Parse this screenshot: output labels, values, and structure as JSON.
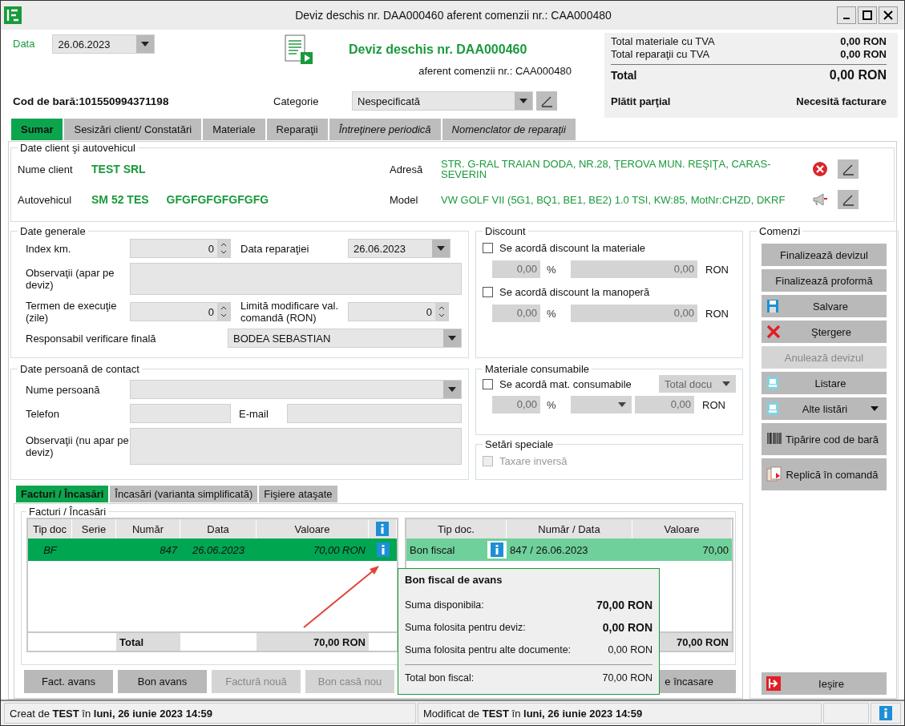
{
  "window": {
    "title": "Deviz deschis nr. DAA000460 aferent comenzii nr.: CAA000480"
  },
  "header": {
    "date_label": "Data",
    "date": "26.06.2023",
    "doc_title": "Deviz deschis nr. DAA000460",
    "order_ref": "aferent comenzii nr.: CAA000480",
    "barcode": "Cod de bară:101550994371198",
    "category_label": "Categorie",
    "category": "Nespecificată"
  },
  "totals": {
    "lines": [
      {
        "label": "Total materiale cu TVA",
        "value": "0,00 RON"
      },
      {
        "label": "Total reparaţii cu TVA",
        "value": "0,00 RON"
      }
    ],
    "total_label": "Total",
    "total": "0,00 RON",
    "payment_status": "Plătit parţial",
    "billing_status": "Necesită facturare"
  },
  "tabs": [
    {
      "label": "Sumar",
      "selected": true,
      "italic": false
    },
    {
      "label": "Sesizări client/ Constatări",
      "selected": false,
      "italic": false
    },
    {
      "label": "Materiale",
      "selected": false,
      "italic": false
    },
    {
      "label": "Reparaţii",
      "selected": false,
      "italic": false
    },
    {
      "label": "Întreţinere periodică",
      "selected": false,
      "italic": true
    },
    {
      "label": "Nomenclator de reparaţii",
      "selected": false,
      "italic": true
    }
  ],
  "client": {
    "title": "Date client şi autovehicul",
    "client_label": "Nume client",
    "client_name": "TEST SRL",
    "vehicle_label": "Autovehicul",
    "plate": "SM 52 TES",
    "vin": "GFGFGFGFGFGFG",
    "address_label": "Adresă",
    "address": "STR. G-RAL TRAIAN DODA, NR.28, ŢEROVA MUN. REŞIŢA, CARAS-SEVERIN",
    "model_label": "Model",
    "model": "VW GOLF VII (5G1, BQ1, BE1, BE2) 1.0 TSI, KW:85, MotNr:CHZD, DKRF"
  },
  "general": {
    "title": "Date generale",
    "index_label": "Index km.",
    "index": "0",
    "repair_date_label": "Data reparaţiei",
    "repair_date": "26.06.2023",
    "notes_label": "Observaţii (apar pe deviz)",
    "term_label": "Termen de execuţie (zile)",
    "term": "0",
    "limit_label": "Limită modificare val. comandă (RON)",
    "limit": "0",
    "inspector_label": "Responsabil verificare finală",
    "inspector": "BODEA SEBASTIAN"
  },
  "contact": {
    "title": "Date persoană de contact",
    "name_label": "Nume persoană",
    "phone_label": "Telefon",
    "email_label": "E-mail",
    "notes_label": "Observaţii (nu apar pe deviz)"
  },
  "discount": {
    "title": "Discount",
    "rows": [
      {
        "label": "Se acordă discount la materiale",
        "checked": false,
        "percent": "0,00",
        "percent_sign": "%",
        "amount": "0,00",
        "currency": "RON"
      },
      {
        "label": "Se acordă discount la manoperă",
        "checked": false,
        "percent": "0,00",
        "percent_sign": "%",
        "amount": "0,00",
        "currency": "RON"
      }
    ]
  },
  "consumables": {
    "title": "Materiale consumabile",
    "label": "Se acordă mat. consumabile",
    "checked": false,
    "basis": "Total docu",
    "percent": "0,00",
    "percent_sign": "%",
    "amount": "0,00",
    "currency": "RON"
  },
  "special": {
    "title": "Setări speciale",
    "label": "Taxare inversă",
    "checked": false,
    "disabled": true
  },
  "commands": {
    "title": "Comenzi",
    "buttons": [
      {
        "label": "Finalizează devizul",
        "kind": "plain",
        "disabled": false
      },
      {
        "label": "Finalizează proformă",
        "kind": "plain",
        "disabled": false
      },
      {
        "label": "Salvare",
        "kind": "save",
        "disabled": false
      },
      {
        "label": "Ştergere",
        "kind": "delete",
        "disabled": false
      },
      {
        "label": "Anulează devizul",
        "kind": "plain",
        "disabled": true
      },
      {
        "label": "Listare",
        "kind": "print",
        "disabled": false
      },
      {
        "label": "Alte listări",
        "kind": "print-menu",
        "disabled": false
      },
      {
        "label": "Tipărire cod de bară",
        "kind": "barcode",
        "disabled": false
      },
      {
        "label": "Replică în comandă",
        "kind": "replicate",
        "disabled": false
      }
    ],
    "exit": {
      "label": "Ieşire"
    }
  },
  "bottom_tabs": [
    {
      "label": "Facturi / Încasări",
      "selected": true
    },
    {
      "label": "Încasări (varianta simplificată)",
      "selected": false
    },
    {
      "label": "Fişiere ataşate",
      "selected": false
    }
  ],
  "invoices": {
    "title": "Facturi / Încasări",
    "columns": [
      "Tip doc",
      "Serie",
      "Număr",
      "Data",
      "Valoare"
    ],
    "rows": [
      {
        "type": "BF",
        "number": "847",
        "date": "26.06.2023",
        "value": "70,00 RON",
        "selected": true
      }
    ],
    "total_label": "Total",
    "total": "70,00 RON",
    "buttons": [
      {
        "label": "Fact. avans",
        "disabled": false
      },
      {
        "label": "Bon avans",
        "disabled": false
      },
      {
        "label": "Factură nouă",
        "disabled": true
      },
      {
        "label": "Bon casă nou",
        "disabled": true
      },
      {
        "label": "e încasare",
        "disabled": false
      }
    ]
  },
  "receipts": {
    "columns": [
      "Tip doc.",
      "Număr / Data",
      "Valoare"
    ],
    "rows": [
      {
        "type": "Bon fiscal",
        "number_date": "847 / 26.06.2023",
        "value": "70,00",
        "selected": true
      }
    ],
    "total": "70,00 RON"
  },
  "popup": {
    "title": "Bon fiscal de avans",
    "lines": [
      {
        "label": "Suma disponibila:",
        "value": "70,00 RON",
        "bold": true
      },
      {
        "label": "Suma folosita pentru deviz:",
        "value": "0,00 RON",
        "bold": true
      },
      {
        "label": "Suma folosita pentru alte documente:",
        "value": "0,00 RON",
        "bold": false
      }
    ],
    "total_label": "Total bon fiscal:",
    "total": "70,00 RON"
  },
  "status": {
    "created": "Creat de **TEST** în **luni, 26 iunie 2023 14:59**",
    "modified": "Modificat de **TEST** în **luni, 26 iunie 2023 14:59**"
  }
}
